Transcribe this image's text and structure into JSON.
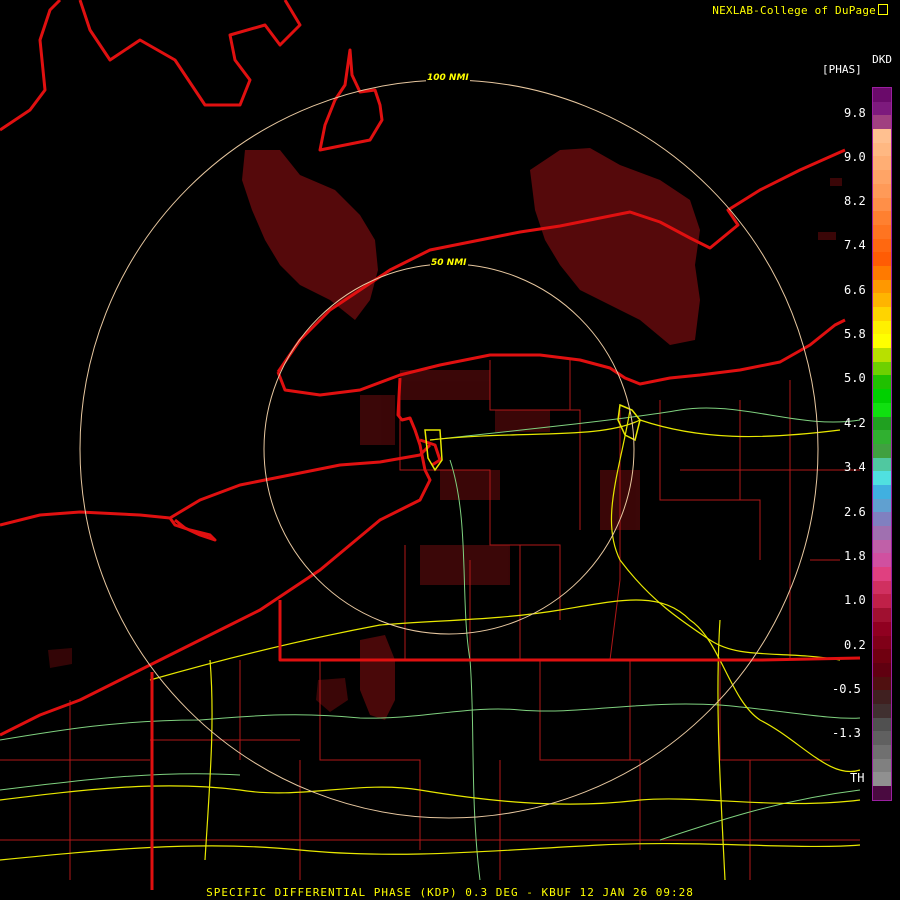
{
  "credit": {
    "text": "NEXLAB-College of DuPage",
    "icon": "external-link-icon"
  },
  "product_code": "DKD",
  "units": "[PHAS]",
  "range_rings": [
    {
      "label": "100 NMI"
    },
    {
      "label": "50 NMI"
    }
  ],
  "colorbar": {
    "ticks": [
      "9.8",
      "9.0",
      "8.2",
      "7.4",
      "6.6",
      "5.8",
      "5.0",
      "4.2",
      "3.4",
      "2.6",
      "1.8",
      "1.0",
      "0.2",
      "-0.5",
      "-1.3",
      "TH"
    ],
    "colors": [
      "#6a0a6a",
      "#7d1a7d",
      "#a04080",
      "#ffc090",
      "#ffb882",
      "#ffae74",
      "#ffa466",
      "#ff9a58",
      "#ff8f48",
      "#ff8030",
      "#ff7420",
      "#ff6810",
      "#ff5c04",
      "#ff7a00",
      "#ff9800",
      "#ffb400",
      "#ffd400",
      "#fff000",
      "#ffff00",
      "#b8e000",
      "#6ed000",
      "#20c000",
      "#00d000",
      "#10e010",
      "#20a020",
      "#30b030",
      "#40a040",
      "#50c8a0",
      "#50e0e0",
      "#40b0e0",
      "#60a0d0",
      "#8080c0",
      "#a070b0",
      "#c060a8",
      "#d050a0",
      "#e04080",
      "#d03060",
      "#c02048",
      "#a01030",
      "#900020",
      "#800018",
      "#700010",
      "#600010",
      "#501010",
      "#402020",
      "#403030",
      "#505050",
      "#606060",
      "#707070",
      "#808080",
      "#909090",
      "#4a0a40"
    ]
  },
  "footer": "SPECIFIC DIFFERENTIAL PHASE (KDP) 0.3 DEG - KBUF 12 JAN 26 09:28"
}
